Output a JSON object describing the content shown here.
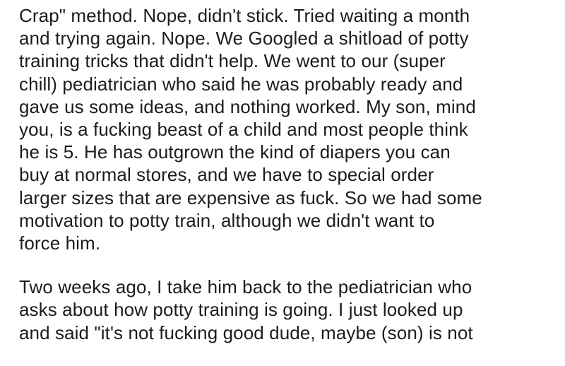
{
  "paragraphs": [
    {
      "lines": [
        "Crap\" method. Nope, didn't stick. Tried waiting a month",
        "and trying again. Nope. We Googled a shitload of potty",
        "training tricks that didn't help. We went to our (super",
        "chill) pediatrician who said he was probably ready and",
        "gave us some ideas, and nothing worked. My son, mind",
        "you, is a fucking beast of a child and most people think",
        "he is 5. He has outgrown the kind of diapers you can",
        "buy at normal stores, and we have to special order",
        "larger sizes that are expensive as fuck. So we had some",
        "motivation to potty train, although we didn't want to",
        "force him."
      ]
    },
    {
      "lines": [
        "Two weeks ago, I take him back to the pediatrician who",
        "asks about how potty training is going. I just looked up",
        "and said \"it's not fucking good dude, maybe (son) is not"
      ]
    }
  ]
}
